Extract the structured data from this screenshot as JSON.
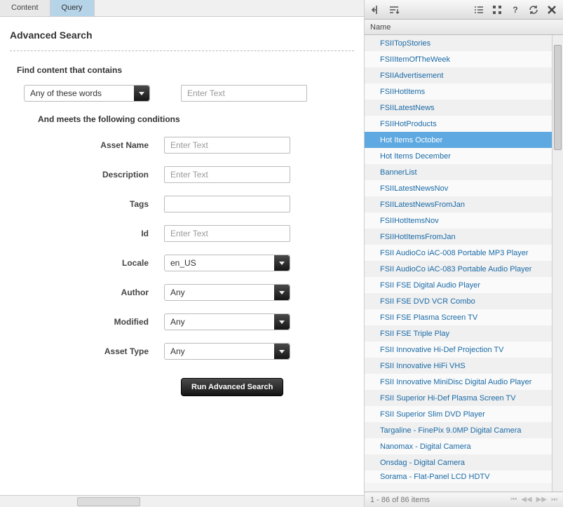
{
  "tabs": {
    "content": "Content",
    "query": "Query",
    "active": "query"
  },
  "title": "Advanced Search",
  "sections": {
    "contains": "Find content that contains",
    "conditions": "And meets the following conditions"
  },
  "wordsSelect": {
    "value": "Any of these words",
    "placeholder": "Enter Text"
  },
  "fields": {
    "assetName": {
      "label": "Asset Name",
      "placeholder": "Enter Text"
    },
    "description": {
      "label": "Description",
      "placeholder": "Enter Text"
    },
    "tags": {
      "label": "Tags",
      "placeholder": ""
    },
    "id": {
      "label": "Id",
      "placeholder": "Enter Text"
    },
    "locale": {
      "label": "Locale",
      "value": "en_US"
    },
    "author": {
      "label": "Author",
      "value": "Any"
    },
    "modified": {
      "label": "Modified",
      "value": "Any"
    },
    "assetType": {
      "label": "Asset Type",
      "value": "Any"
    }
  },
  "runButton": "Run Advanced Search",
  "results": {
    "header": "Name",
    "selectedIndex": 6,
    "items": [
      "FSIITopStories",
      "FSIIItemOfTheWeek",
      "FSIIAdvertisement",
      "FSIIHotItems",
      "FSIILatestNews",
      "FSIIHotProducts",
      "Hot Items October",
      "Hot Items December",
      "BannerList",
      "FSIILatestNewsNov",
      "FSIILatestNewsFromJan",
      "FSIIHotItemsNov",
      "FSIIHotItemsFromJan",
      "FSII AudioCo iAC-008 Portable MP3 Player",
      "FSII AudioCo iAC-083 Portable Audio Player",
      "FSII FSE Digital Audio Player",
      "FSII FSE DVD VCR Combo",
      "FSII FSE Plasma Screen TV",
      "FSII FSE Triple Play",
      "FSII Innovative Hi-Def Projection TV",
      "FSII Innovative HiFi VHS",
      "FSII Innovative MiniDisc Digital Audio Player",
      "FSII Superior Hi-Def Plasma Screen TV",
      "FSII Superior Slim DVD Player",
      "Targaline - FinePix 9.0MP Digital Camera",
      "Nanomax - Digital Camera",
      "Onsdag - Digital Camera",
      "Sorama - Flat-Panel LCD HDTV"
    ],
    "pager": "1 - 86 of 86 items"
  }
}
